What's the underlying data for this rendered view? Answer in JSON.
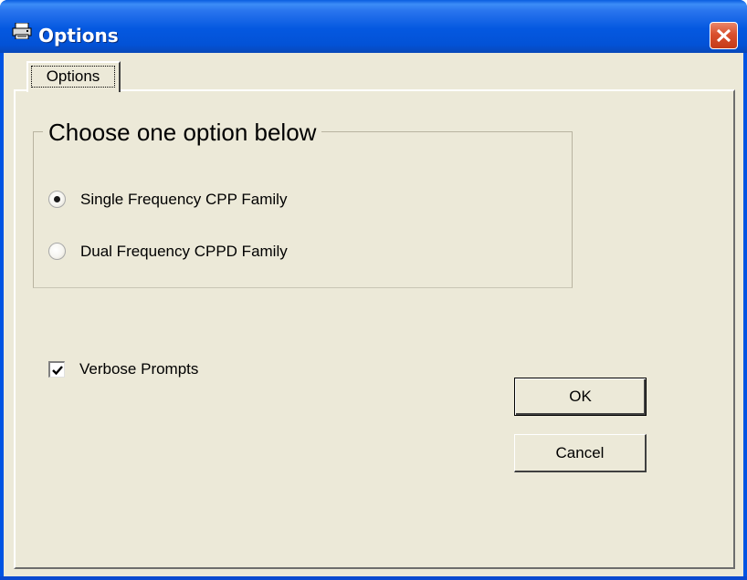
{
  "window": {
    "title": "Options",
    "icon": "printer-icon",
    "close_icon": "close-icon",
    "accent_color": "#0054e3",
    "close_color": "#d9502e"
  },
  "tabs": [
    {
      "label": "Options",
      "selected": true
    }
  ],
  "group": {
    "legend": "Choose one option below",
    "options": [
      {
        "label": "Single Frequency CPP Family",
        "selected": true
      },
      {
        "label": "Dual Frequency CPPD Family",
        "selected": false
      }
    ]
  },
  "verbose": {
    "label": "Verbose Prompts",
    "checked": true
  },
  "buttons": {
    "ok": "OK",
    "cancel": "Cancel"
  }
}
